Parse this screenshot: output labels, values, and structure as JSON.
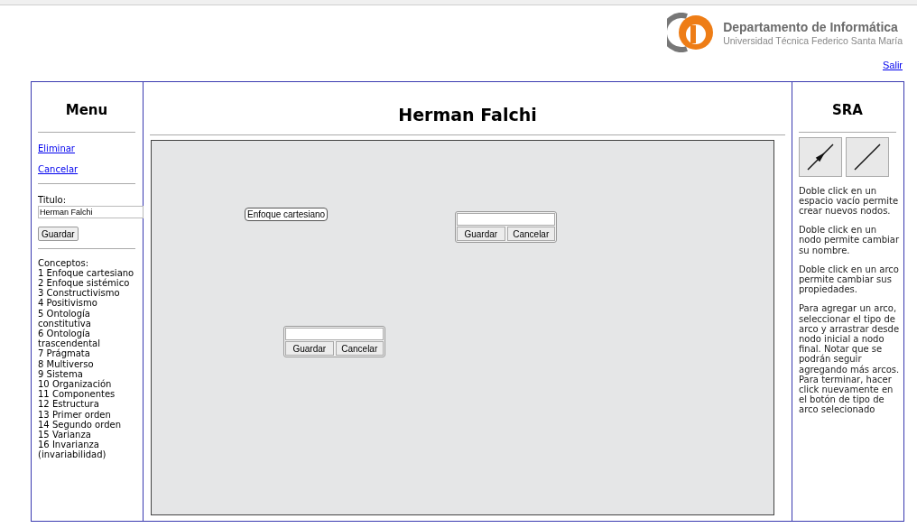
{
  "header": {
    "department": "Departamento de Informática",
    "university": "Universidad Técnica Federico Santa María",
    "logout": "Salir"
  },
  "menu": {
    "heading": "Menu",
    "links": [
      "Eliminar",
      "Cancelar"
    ],
    "title_label": "Titulo:",
    "title_value": "Herman Falchi",
    "save_button": "Guardar",
    "concepts_label": "Conceptos:",
    "concepts": [
      "1 Enfoque cartesiano",
      "2 Enfoque sistémico",
      "3 Constructivismo",
      "4 Positivismo",
      "5 Ontología constitutiva",
      "6 Ontología trascendental",
      "7 Prágmata",
      "8 Multiverso",
      "9 Sistema",
      "10 Organización",
      "11 Componentes",
      "12 Estructura",
      "13 Primer orden",
      "14 Segundo orden",
      "15 Varianza",
      "16 Invarianza (invariabilidad)"
    ]
  },
  "page_title": "Herman Falchi",
  "canvas": {
    "nodes": [
      {
        "label": "Enfoque cartesiano"
      }
    ],
    "editors": [
      {
        "save": "Guardar",
        "cancel": "Cancelar"
      },
      {
        "save": "Guardar",
        "cancel": "Cancelar"
      }
    ]
  },
  "sra": {
    "heading": "SRA",
    "arc_tools": [
      {
        "kind": "directed"
      },
      {
        "kind": "undirected"
      }
    ],
    "help": [
      "Doble click en un espacio vacío permite crear nuevos nodos.",
      "Doble click en un nodo permite cambiar su nombre.",
      "Doble click en un arco permite cambiar sus propiedades.",
      "Para agregar un arco, seleccionar el tipo de arco y arrastrar desde nodo inicial a nodo final. Notar que se podrán seguir agregando más arcos. Para terminar, hacer click nuevamente en el botón de tipo de arco selecionado"
    ]
  }
}
